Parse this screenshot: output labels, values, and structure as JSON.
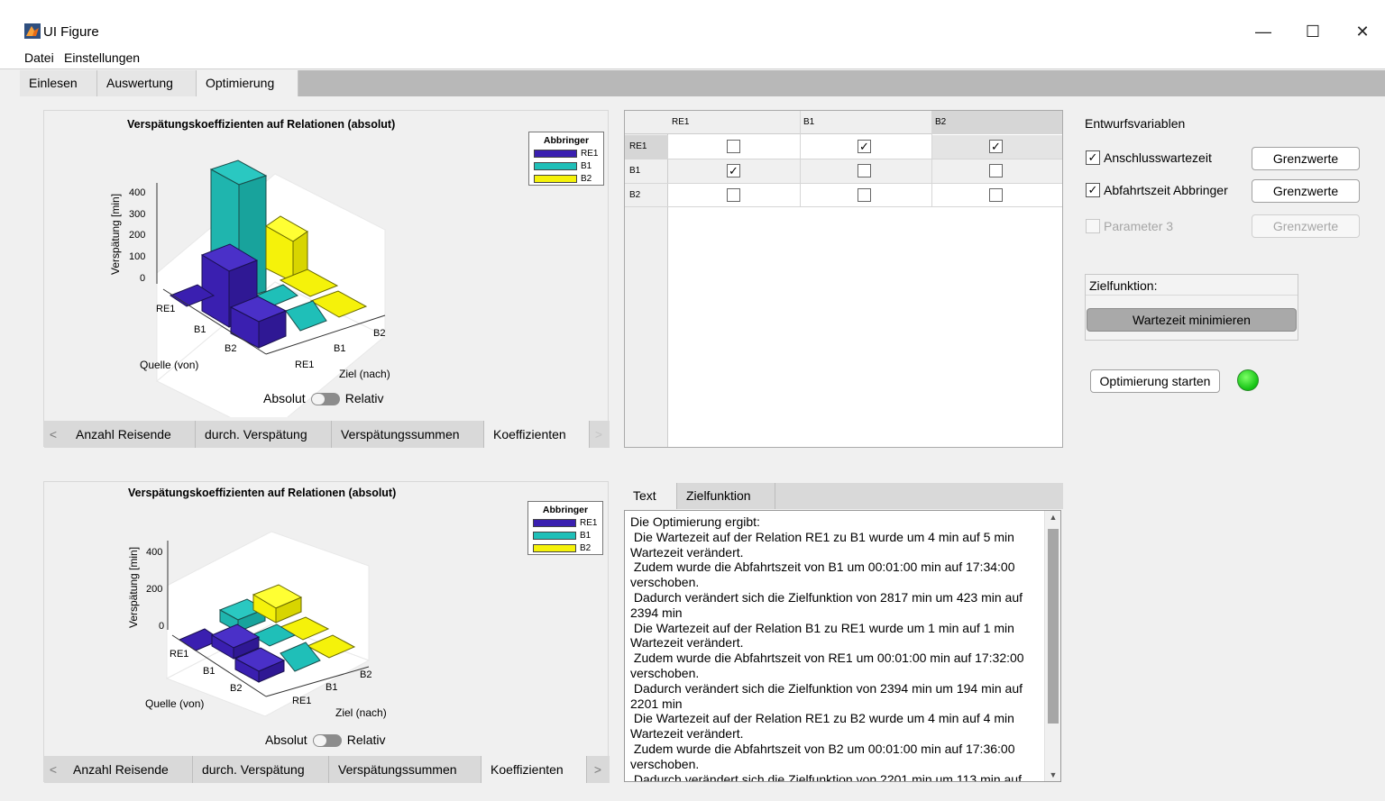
{
  "window": {
    "title": "UI Figure",
    "minimize": "—",
    "maximize": "☐",
    "close": "✕"
  },
  "menu": {
    "file": "Datei",
    "settings": "Einstellungen"
  },
  "main_tabs": [
    "Einlesen",
    "Auswertung",
    "Optimierung"
  ],
  "plot_top": {
    "title": "Verspätungskoeffizienten auf Relationen (absolut)",
    "zlabel": "Verspätung [min]",
    "zticks": [
      "400",
      "300",
      "200",
      "100",
      "0"
    ],
    "source_label": "Quelle (von)",
    "target_label": "Ziel (nach)",
    "source_ticks": [
      "RE1",
      "B1",
      "B2"
    ],
    "target_ticks": [
      "RE1",
      "B1",
      "B2"
    ],
    "legend_title": "Abbringer",
    "legend": [
      {
        "name": "RE1",
        "color": "#3a1fb0"
      },
      {
        "name": "B1",
        "color": "#1fbfb8"
      },
      {
        "name": "B2",
        "color": "#f5f20a"
      }
    ],
    "toggle_left": "Absolut",
    "toggle_right": "Relativ"
  },
  "plot_bottom": {
    "title": "Verspätungskoeffizienten auf Relationen (absolut)",
    "zlabel": "Verspätung [min]",
    "zticks": [
      "400",
      "200",
      "0"
    ],
    "source_label": "Quelle (von)",
    "target_label": "Ziel (nach)",
    "source_ticks": [
      "RE1",
      "B1",
      "B2"
    ],
    "target_ticks": [
      "RE1",
      "B1",
      "B2"
    ],
    "legend_title": "Abbringer",
    "legend": [
      {
        "name": "RE1",
        "color": "#3a1fb0"
      },
      {
        "name": "B1",
        "color": "#1fbfb8"
      },
      {
        "name": "B2",
        "color": "#f5f20a"
      }
    ],
    "toggle_left": "Absolut",
    "toggle_right": "Relativ"
  },
  "sub_tabs": [
    "Anzahl Reisende",
    "durch. Verspätung",
    "Verspätungssummen",
    "Koeffizienten"
  ],
  "relation_table": {
    "columns": [
      "RE1",
      "B1",
      "B2"
    ],
    "rows": [
      {
        "name": "RE1",
        "checked": [
          false,
          true,
          true
        ]
      },
      {
        "name": "B1",
        "checked": [
          true,
          false,
          false
        ]
      },
      {
        "name": "B2",
        "checked": [
          false,
          false,
          false
        ]
      }
    ]
  },
  "design_vars": {
    "title": "Entwurfsvariablen",
    "items": [
      {
        "label": "Anschlusswartezeit",
        "checked": true,
        "enabled": true,
        "button": "Grenzwerte"
      },
      {
        "label": "Abfahrtszeit Abbringer",
        "checked": true,
        "enabled": true,
        "button": "Grenzwerte"
      },
      {
        "label": "Parameter 3",
        "checked": false,
        "enabled": false,
        "button": "Grenzwerte"
      }
    ]
  },
  "objective": {
    "label": "Zielfunktion:",
    "button": "Wartezeit minimieren"
  },
  "start_button": "Optimierung starten",
  "status_lamp_color": "#13c213",
  "output_tabs": [
    "Text",
    "Zielfunktion"
  ],
  "output_lines": [
    "Die Optimierung ergibt:",
    " Die Wartezeit auf der Relation RE1 zu B1 wurde um 4 min auf 5 min Wartezeit verändert.",
    " Zudem wurde die Abfahrtszeit von B1 um 00:01:00 min auf 17:34:00 verschoben.",
    " Dadurch verändert sich die Zielfunktion von 2817 min um 423 min auf 2394 min",
    " Die Wartezeit auf der Relation B1 zu RE1 wurde um 1 min auf 1 min Wartezeit verändert.",
    " Zudem wurde die Abfahrtszeit von RE1 um 00:01:00 min auf 17:32:00 verschoben.",
    " Dadurch verändert sich die Zielfunktion von 2394 min um 194 min auf 2201 min",
    " Die Wartezeit auf der Relation RE1 zu B2 wurde um 4 min auf 4 min Wartezeit verändert.",
    " Zudem wurde die Abfahrtszeit von B2 um 00:01:00 min auf 17:36:00 verschoben.",
    " Dadurch verändert sich die Zielfunktion von 2201 min um 113 min auf"
  ]
}
